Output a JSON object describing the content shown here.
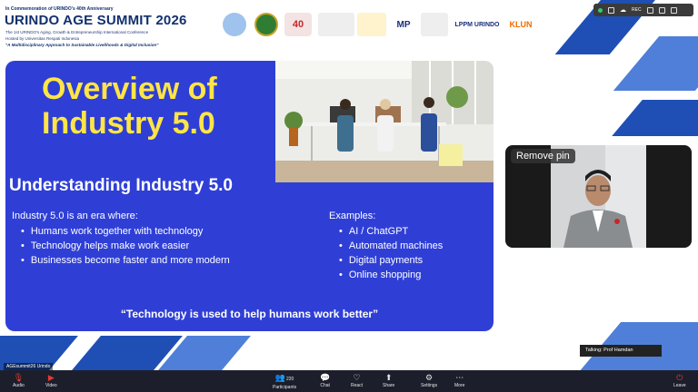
{
  "header": {
    "commemoration": "In Commemoration of URINDO's 40th Anniversary",
    "title": "URINDO AGE SUMMIT 2026",
    "subtitle_line1": "The 1st URINDO's Aging, Growth & Entrepreneurship International Conference",
    "subtitle_line2": "Hosted by Universitas Respati Indonesia",
    "theme": "\"A Multidisciplinary Approach to Sustainable Livelihoods & Digital Inclusion\"",
    "logos": [
      "MP",
      "LPPM URINDO",
      "KLUN"
    ]
  },
  "slide": {
    "title_line1": "Overview of",
    "title_line2": "Industry 5.0",
    "heading": "Understanding Industry 5.0",
    "intro": "Industry 5.0 is an era where:",
    "bullets_left": [
      "Humans work together with technology",
      "Technology helps make work easier",
      "Businesses become faster and more modern"
    ],
    "examples_label": "Examples:",
    "bullets_right": [
      "AI / ChatGPT",
      "Automated machines",
      "Digital payments",
      "Online shopping"
    ],
    "quote": "“Technology is used to help humans work better”"
  },
  "video": {
    "remove_pin": "Remove pin",
    "talking": "Talking: Prof Hamdan"
  },
  "status_bar": {
    "rec_label": "REC"
  },
  "toolbar": {
    "self_name": "AGEsummit26 Urindo",
    "audio": "Audio",
    "video": "Video",
    "participants": "Participants",
    "participants_count": "220",
    "chat": "Chat",
    "react": "React",
    "share": "Share",
    "settings": "Settings",
    "more": "More",
    "leave": "Leave"
  }
}
